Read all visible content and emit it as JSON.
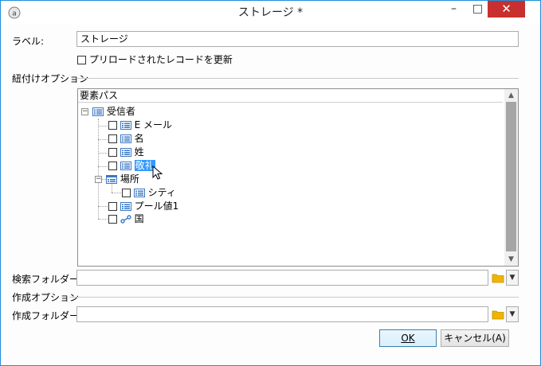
{
  "window": {
    "title": "ストレージ *",
    "minimize_glyph": "–",
    "maximize_glyph": "□",
    "close_glyph": "✕"
  },
  "label_field": {
    "label": "ラベル:",
    "value": "ストレージ"
  },
  "preload_checkbox": {
    "label": "プリロードされたレコードを更新",
    "checked": false
  },
  "link_options": {
    "section_title": "紐付けオプション",
    "tree_header": "要素パス",
    "tree": [
      {
        "label": "受信者",
        "icon": "list-icon",
        "expanded": true,
        "checked": null
      },
      {
        "label": "E メール",
        "icon": "list-icon",
        "checked": false
      },
      {
        "label": "名",
        "icon": "list-icon",
        "checked": false
      },
      {
        "label": "姓",
        "icon": "list-icon",
        "checked": false
      },
      {
        "label": "敬礼",
        "icon": "list-icon",
        "checked": false,
        "selected": true
      },
      {
        "label": "場所",
        "icon": "folder-list-icon",
        "expanded": true,
        "checked": null
      },
      {
        "label": "シティ",
        "icon": "list-icon",
        "checked": false
      },
      {
        "label": "プール値1",
        "icon": "list-icon",
        "checked": false
      },
      {
        "label": "国",
        "icon": "link-icon",
        "checked": false
      }
    ]
  },
  "search_folder": {
    "label": "検索フォルダー:",
    "value": ""
  },
  "create_options": {
    "section_title": "作成オプション",
    "folder_label": "作成フォルダー:",
    "folder_value": ""
  },
  "buttons": {
    "ok_label": "OK",
    "cancel_label": "キャンセル(A)"
  },
  "colors": {
    "close_button": "#c7302e",
    "selection": "#3399ff",
    "window_border": "#1d8fd8",
    "folder_icon": "#f0b400"
  }
}
